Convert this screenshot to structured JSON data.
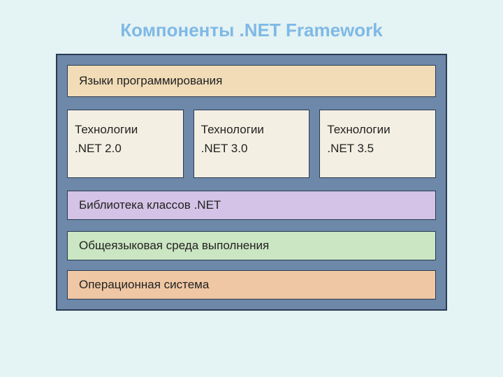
{
  "title": "Компоненты .NET Framework",
  "layers": {
    "languages": "Языки программирования",
    "technologies": [
      {
        "line1": "Технологии",
        "line2": ".NET 2.0"
      },
      {
        "line1": "Технологии",
        "line2": ".NET 3.0"
      },
      {
        "line1": "Технологии",
        "line2": ".NET 3.5"
      }
    ],
    "library": "Библиотека классов .NET",
    "clr": "Общеязыковая среда выполнения",
    "os": "Операционная система"
  }
}
